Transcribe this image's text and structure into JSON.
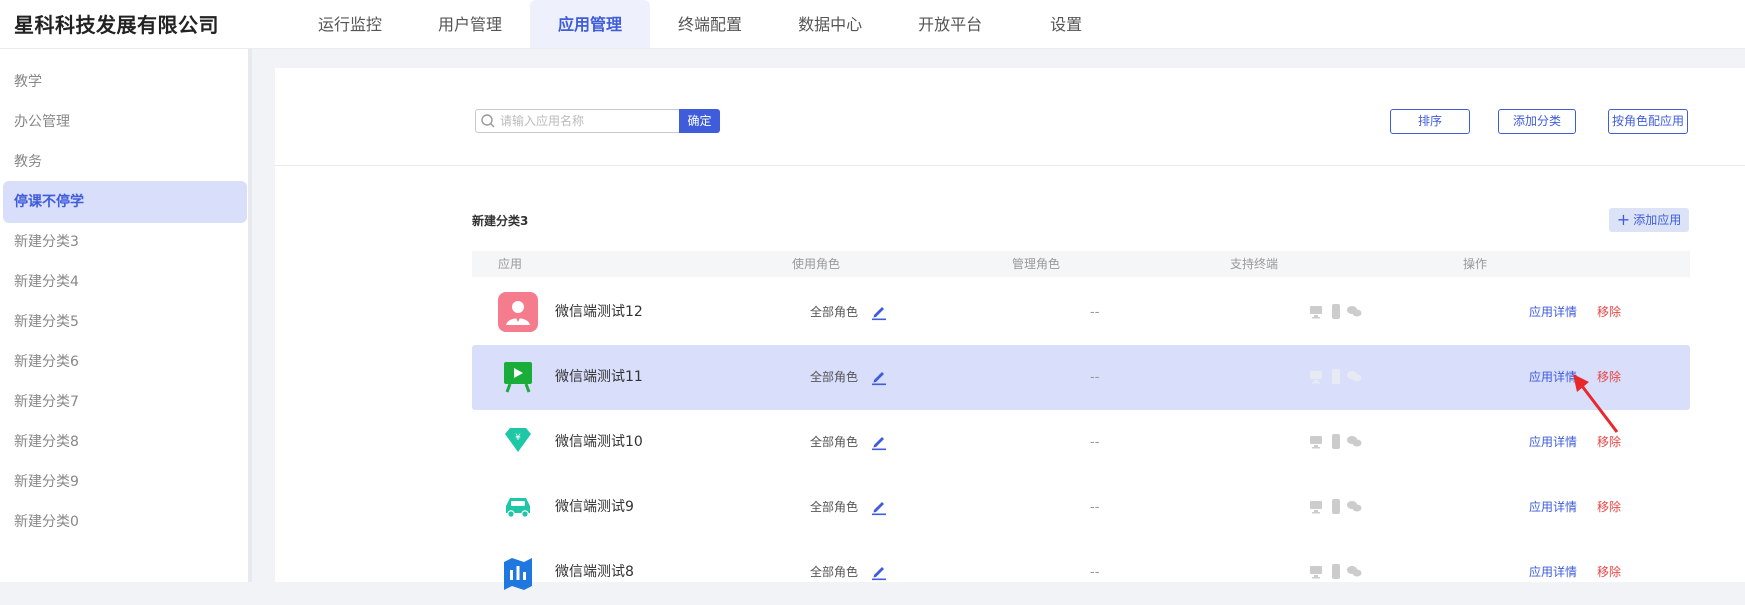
{
  "company": "星科科技发展有限公司",
  "nav": [
    {
      "label": "运行监控"
    },
    {
      "label": "用户管理"
    },
    {
      "label": "应用管理",
      "active": true
    },
    {
      "label": "终端配置"
    },
    {
      "label": "数据中心"
    },
    {
      "label": "开放平台"
    },
    {
      "label": "设置"
    }
  ],
  "sidebar": {
    "items": [
      {
        "label": "教学"
      },
      {
        "label": "办公管理"
      },
      {
        "label": "教务"
      },
      {
        "label": "停课不停学",
        "active": true
      },
      {
        "label": "新建分类3"
      },
      {
        "label": "新建分类4"
      },
      {
        "label": "新建分类5"
      },
      {
        "label": "新建分类6"
      },
      {
        "label": "新建分类7"
      },
      {
        "label": "新建分类8"
      },
      {
        "label": "新建分类9"
      },
      {
        "label": "新建分类0"
      }
    ]
  },
  "toolbar": {
    "search_placeholder": "请输入应用名称",
    "confirm_label": "确定",
    "sort_label": "排序",
    "add_category_label": "添加分类",
    "role_assign_label": "按角色配应用"
  },
  "category": {
    "title": "新建分类3",
    "add_app_label": "添加应用"
  },
  "table": {
    "headers": {
      "app": "应用",
      "use_role": "使用角色",
      "manage_role": "管理角色",
      "terminals": "支持终端",
      "actions": "操作"
    },
    "rows": [
      {
        "name": "微信端测试12",
        "role": "全部角色",
        "manage": "--",
        "icon": "user-avatar-icon",
        "icon_color": "#f47c8c",
        "detail": "应用详情",
        "remove": "移除"
      },
      {
        "name": "微信端测试11",
        "role": "全部角色",
        "manage": "--",
        "icon": "video-board-icon",
        "icon_color": "#1aad3a",
        "detail": "应用详情",
        "remove": "移除",
        "selected": true
      },
      {
        "name": "微信端测试10",
        "role": "全部角色",
        "manage": "--",
        "icon": "money-diamond-icon",
        "icon_color": "#1ec8a6",
        "detail": "应用详情",
        "remove": "移除"
      },
      {
        "name": "微信端测试9",
        "role": "全部角色",
        "manage": "--",
        "icon": "car-icon",
        "icon_color": "#1ec8a6",
        "detail": "应用详情",
        "remove": "移除"
      },
      {
        "name": "微信端测试8",
        "role": "全部角色",
        "manage": "--",
        "icon": "map-icon",
        "icon_color": "#1f78e0",
        "detail": "应用详情",
        "remove": "移除"
      }
    ]
  },
  "colors": {
    "accent": "#3f5ddb",
    "danger": "#e84545",
    "selected_bg": "#d9defb",
    "annotation_arrow": "#e8282b"
  }
}
